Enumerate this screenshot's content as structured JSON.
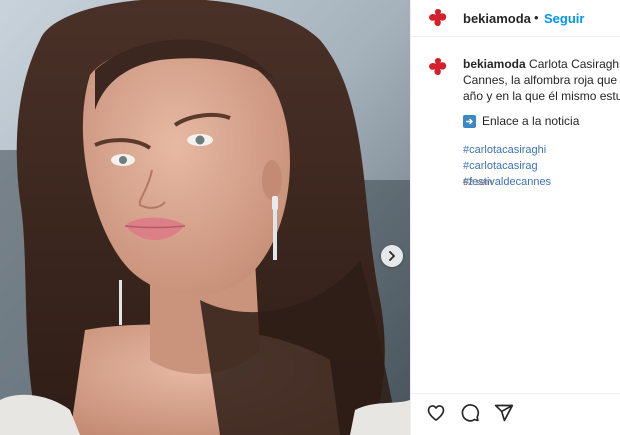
{
  "brand_color": "#d3202a",
  "link_color": "#0095f6",
  "hashtag_color": "#3b73b9",
  "account": {
    "username": "bekiamoda",
    "follow_label": "Seguir",
    "separator": "•",
    "avatar_icon": "bekia-logo-icon"
  },
  "caption": {
    "username": "bekiamoda",
    "line1": "Carlota Casiraghi se",
    "line2": "Cannes, la alfombra roja que pis",
    "line3": "año y en la que él mismo estuvo",
    "link_emoji": "right-arrow-icon",
    "link_text": "Enlace a la noticia",
    "hashtags": [
      "#carlotacasiraghi",
      "#carlotacasirag",
      "#festivaldecannes"
    ],
    "time": "62 sem"
  },
  "media": {
    "image_icon": "portrait-photo",
    "next_icon": "chevron-right-icon"
  },
  "actions": [
    "heart-icon",
    "comment-icon",
    "share-icon"
  ]
}
